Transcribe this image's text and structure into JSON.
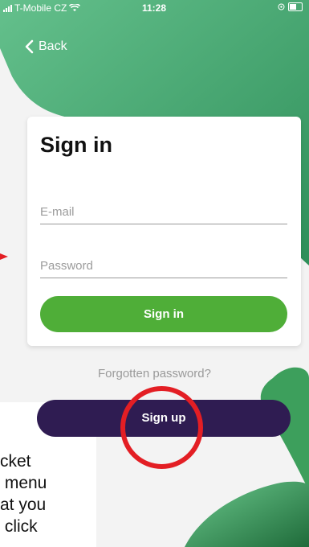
{
  "status_bar": {
    "carrier": "T-Mobile CZ",
    "time": "11:28"
  },
  "nav": {
    "back_label": "Back"
  },
  "card": {
    "title": "Sign in",
    "email_placeholder": "E-mail",
    "password_placeholder": "Password",
    "signin_button": "Sign in"
  },
  "forgot_password": "Forgotten password?",
  "signup_button": "Sign up",
  "annotation_text": {
    "line1": "cket",
    "line2": " menu",
    "line3": "at you",
    "line4": " click"
  },
  "colors": {
    "accent_green": "#4fae38",
    "signup_purple": "#2f1c52",
    "highlight_red": "#e31e24",
    "blob_green": "#3fa36e"
  }
}
